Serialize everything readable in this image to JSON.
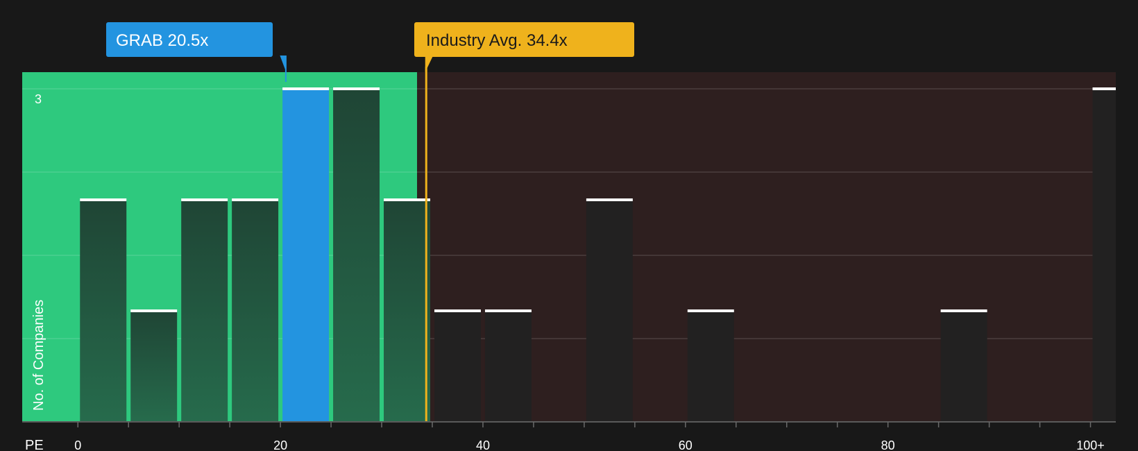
{
  "chart_data": {
    "type": "bar",
    "xlabel": "PE",
    "ylabel": "No. of Companies",
    "xlim": [
      -5.5,
      102.5
    ],
    "ylim": [
      0,
      3.15
    ],
    "x_ticks": [
      0,
      20,
      40,
      60,
      80,
      100
    ],
    "x_tick_labels": [
      "0",
      "20",
      "40",
      "60",
      "80",
      "100+"
    ],
    "y_tick_labels": [
      {
        "value": 3,
        "label": "3"
      }
    ],
    "y_gridlines": [
      0.75,
      1.5,
      2.25,
      3
    ],
    "bin_width": 5,
    "bins": [
      {
        "start": 0,
        "end": 5,
        "count": 2
      },
      {
        "start": 5,
        "end": 10,
        "count": 1
      },
      {
        "start": 10,
        "end": 15,
        "count": 2
      },
      {
        "start": 15,
        "end": 20,
        "count": 2
      },
      {
        "start": 20,
        "end": 25,
        "count": 3,
        "highlight": true
      },
      {
        "start": 25,
        "end": 30,
        "count": 3
      },
      {
        "start": 30,
        "end": 35,
        "count": 2
      },
      {
        "start": 35,
        "end": 40,
        "count": 1
      },
      {
        "start": 40,
        "end": 45,
        "count": 1
      },
      {
        "start": 50,
        "end": 55,
        "count": 2
      },
      {
        "start": 60,
        "end": 65,
        "count": 1
      },
      {
        "start": 85,
        "end": 90,
        "count": 1
      },
      {
        "start": 100,
        "end": 105,
        "count": 3
      }
    ],
    "company": {
      "label": "GRAB 20.5x",
      "value": 20.5,
      "color": "#2394e0"
    },
    "industry_avg": {
      "label": "Industry Avg. 34.4x",
      "value": 34.4,
      "color": "#efb21c"
    },
    "good_zone_end": 33.5,
    "colors": {
      "background": "#181818",
      "good_zone": "#2ec97e",
      "bad_zone": "#2e1f1f",
      "bar_good": "#224b39",
      "bar_bad": "#222121",
      "bar_cap": "#ffffff",
      "grid": "#4a4a4a"
    }
  }
}
